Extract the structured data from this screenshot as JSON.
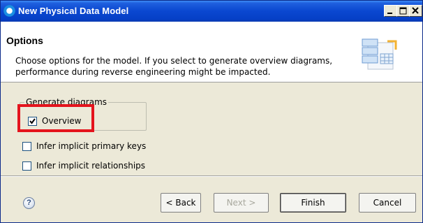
{
  "window": {
    "title": "New Physical Data Model",
    "controls": {
      "minimize": "_",
      "maximize": "□",
      "close": "X"
    }
  },
  "header": {
    "title": "Options",
    "description": "Choose options for the model. If you select to generate overview diagrams, performance during reverse engineering might be impacted.",
    "icon": "data-model-wizard-icon"
  },
  "generate_diagrams": {
    "label": "Generate diagrams",
    "overview": {
      "label": "Overview",
      "checked": true
    }
  },
  "options": [
    {
      "label": "Infer implicit primary keys",
      "checked": false
    },
    {
      "label": "Infer implicit relationships",
      "checked": false
    }
  ],
  "footer": {
    "help_icon": "help-icon",
    "help_label": "?",
    "back_label": "< Back",
    "next_label": "Next >",
    "finish_label": "Finish",
    "cancel_label": "Cancel"
  },
  "colors": {
    "title_bar": "#0a47d0",
    "highlight": "#e4141d",
    "dialog_bg": "#ece9d8"
  }
}
